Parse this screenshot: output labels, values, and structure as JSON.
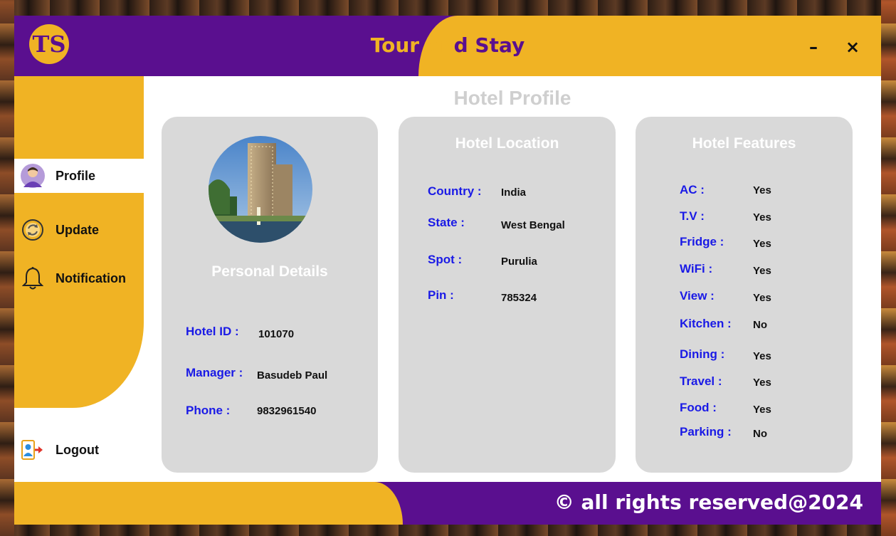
{
  "app": {
    "title_part1": "Tour an",
    "title_part2": "d Stay",
    "logo_text": "TS",
    "minimize_label": "–",
    "close_label": "×"
  },
  "sidebar": {
    "items": [
      {
        "label": "Profile",
        "icon": "user-avatar-icon",
        "active": true
      },
      {
        "label": "Update",
        "icon": "refresh-icon",
        "active": false
      },
      {
        "label": "Notification",
        "icon": "bell-icon",
        "active": false
      }
    ],
    "logout": {
      "label": "Logout",
      "icon": "logout-icon"
    }
  },
  "page": {
    "title": "Hotel Profile"
  },
  "personal": {
    "heading": "Personal Details",
    "fields": [
      {
        "label": "Hotel ID :",
        "value": "101070"
      },
      {
        "label": "Manager :",
        "value": "Basudeb Paul"
      },
      {
        "label": "Phone :",
        "value": "9832961540"
      }
    ]
  },
  "location": {
    "heading": "Hotel Location",
    "fields": [
      {
        "label": "Country :",
        "value": "India"
      },
      {
        "label": "State :",
        "value": "West Bengal"
      },
      {
        "label": "Spot :",
        "value": "Purulia"
      },
      {
        "label": "Pin :",
        "value": "785324"
      }
    ]
  },
  "features": {
    "heading": "Hotel Features",
    "fields": [
      {
        "label": "AC :",
        "value": "Yes"
      },
      {
        "label": "T.V :",
        "value": "Yes"
      },
      {
        "label": "Fridge :",
        "value": "Yes"
      },
      {
        "label": "WiFi :",
        "value": "Yes"
      },
      {
        "label": "View :",
        "value": "Yes"
      },
      {
        "label": "Kitchen :",
        "value": "No"
      },
      {
        "label": "Dining :",
        "value": "Yes"
      },
      {
        "label": "Travel :",
        "value": "Yes"
      },
      {
        "label": "Food :",
        "value": "Yes"
      },
      {
        "label": "Parking :",
        "value": "No"
      }
    ]
  },
  "footer": {
    "text": "© all rights reserved@2024"
  },
  "colors": {
    "purple": "#5a0f8f",
    "yellow": "#f0b324",
    "card": "#d9d9d9",
    "label_blue": "#1a1ae6"
  }
}
